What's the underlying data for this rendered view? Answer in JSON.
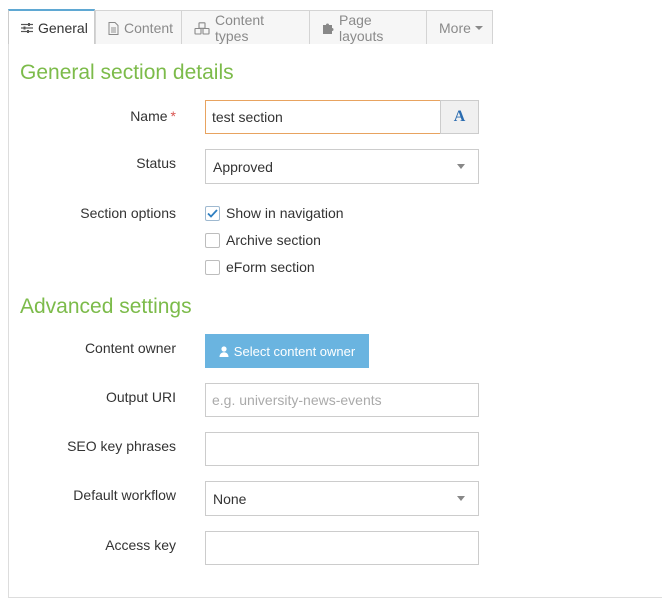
{
  "tabs": [
    {
      "label": "General",
      "icon": "sliders-icon",
      "active": true
    },
    {
      "label": "Content",
      "icon": "document-icon",
      "active": false
    },
    {
      "label": "Content types",
      "icon": "cubes-icon",
      "active": false
    },
    {
      "label": "Page layouts",
      "icon": "puzzle-icon",
      "active": false
    },
    {
      "label": "More",
      "icon": "chevron-down-icon",
      "active": false
    }
  ],
  "general": {
    "title": "General section details",
    "name_label": "Name",
    "required_mark": "*",
    "name_value": "test section",
    "name_addon": "A",
    "status_label": "Status",
    "status_value": "Approved",
    "options_label": "Section options",
    "options": [
      {
        "label": "Show in navigation",
        "checked": true
      },
      {
        "label": "Archive section",
        "checked": false
      },
      {
        "label": "eForm section",
        "checked": false
      }
    ]
  },
  "advanced": {
    "title": "Advanced settings",
    "owner_label": "Content owner",
    "owner_button": "Select content owner",
    "output_uri_label": "Output URI",
    "output_uri_placeholder": "e.g. university-news-events",
    "seo_label": "SEO key phrases",
    "workflow_label": "Default workflow",
    "workflow_value": "None",
    "access_key_label": "Access key"
  },
  "colors": {
    "accent_green": "#7cbb4a",
    "button_blue": "#6ab4e0",
    "required_red": "#d9534f",
    "focus_orange": "#e8a360",
    "active_tab_top": "#5fa8d3"
  }
}
